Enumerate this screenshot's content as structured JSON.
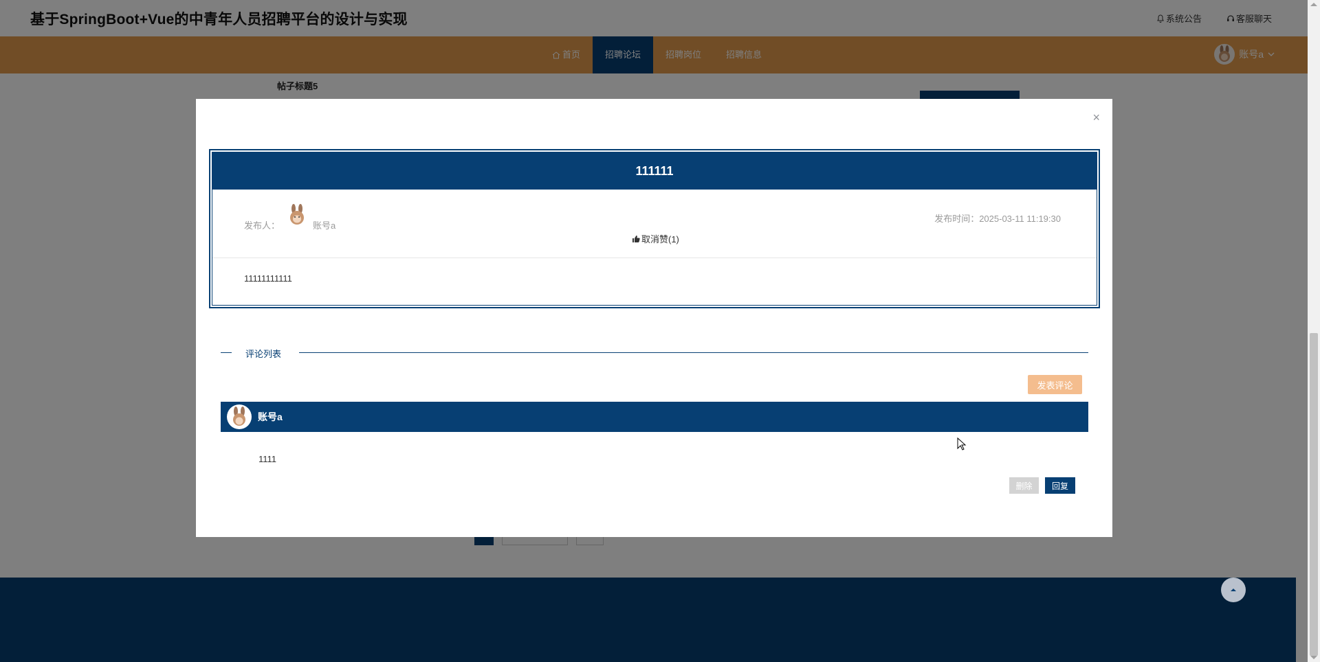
{
  "header": {
    "site_title": "基于SpringBoot+Vue的中青年人员招聘平台的设计与实现",
    "links": [
      {
        "label": "系统公告",
        "icon": "bell-icon"
      },
      {
        "label": "客服聊天",
        "icon": "headset-icon"
      }
    ]
  },
  "nav": {
    "items": [
      {
        "label": "首页",
        "icon": "home-icon",
        "active": false
      },
      {
        "label": "招聘论坛",
        "active": true
      },
      {
        "label": "招聘岗位",
        "active": false
      },
      {
        "label": "招聘信息",
        "active": false
      }
    ],
    "user_name": "账号a"
  },
  "background": {
    "post_title": "帖子标题5"
  },
  "modal": {
    "post": {
      "title": "111111",
      "publisher_label": "发布人：",
      "publisher_name": "账号a",
      "publish_time": "发布时间：2025-03-11 11:19:30",
      "like_label": "取消赞(1)",
      "content": "11111111111"
    },
    "comments_section": {
      "title": "评论列表",
      "post_comment_label": "发表评论",
      "items": [
        {
          "user": "账号a",
          "content": "1111",
          "delete_label": "删除",
          "reply_label": "回复"
        }
      ]
    }
  },
  "colors": {
    "primary": "#073f73",
    "nav_bg": "#e29a4c",
    "accent_light": "#f4bd8e"
  }
}
